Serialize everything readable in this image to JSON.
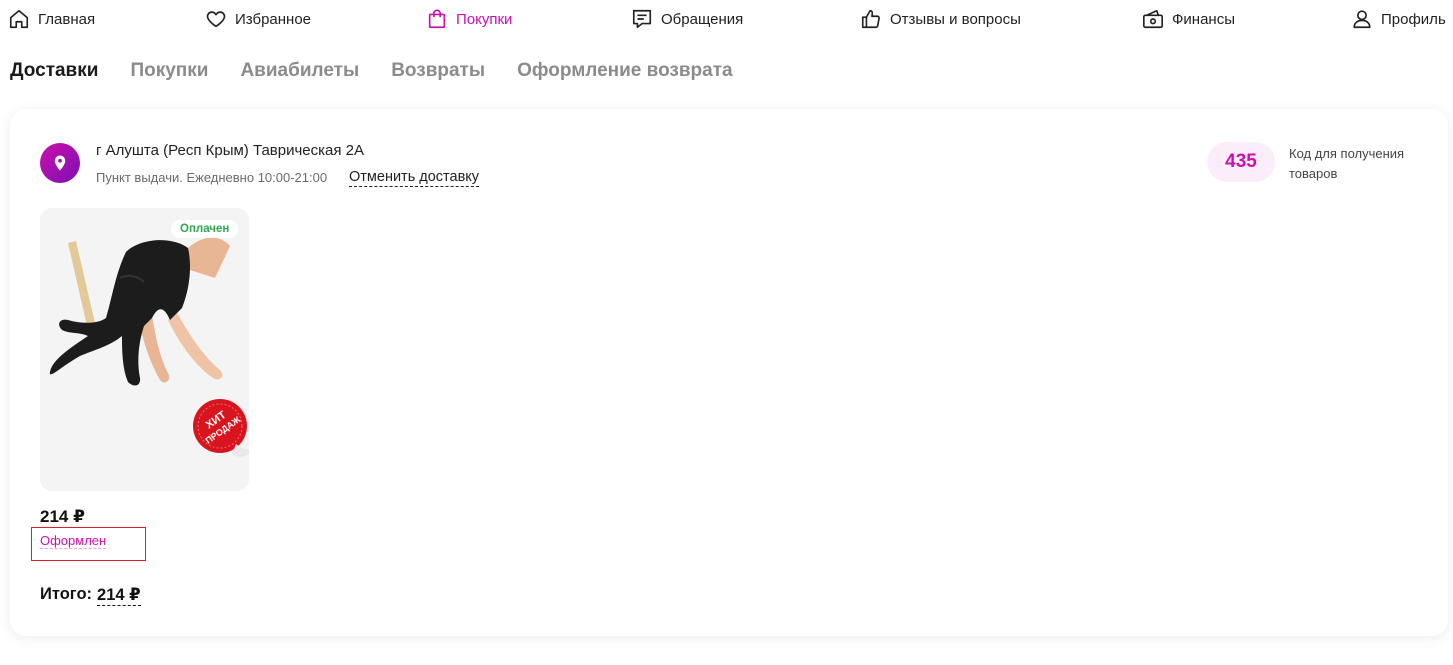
{
  "nav": {
    "home": "Главная",
    "favorites": "Избранное",
    "purchases": "Покупки",
    "requests": "Обращения",
    "reviews": "Отзывы и вопросы",
    "finance": "Финансы",
    "profile": "Профиль"
  },
  "tabs": [
    "Доставки",
    "Покупки",
    "Авиабилеты",
    "Возвраты",
    "Оформление возврата"
  ],
  "delivery": {
    "address": "г Алушта (Респ Крым) Таврическая 2А",
    "point_info": "Пункт выдачи. Ежедневно 10:00-21:00",
    "cancel_label": "Отменить доставку",
    "code": "435",
    "code_label": "Код для получения товаров"
  },
  "product": {
    "badge": "Оплачен",
    "sticker_line1": "ХИТ",
    "sticker_line2": "ПРОДАЖ",
    "price": "214 ₽",
    "status": "Оформлен"
  },
  "total": {
    "label": "Итого:",
    "value": "214 ₽"
  },
  "colors": {
    "accent": "#cb11ab",
    "paid": "#2fa652",
    "highlight_box": "#e01f2a"
  }
}
